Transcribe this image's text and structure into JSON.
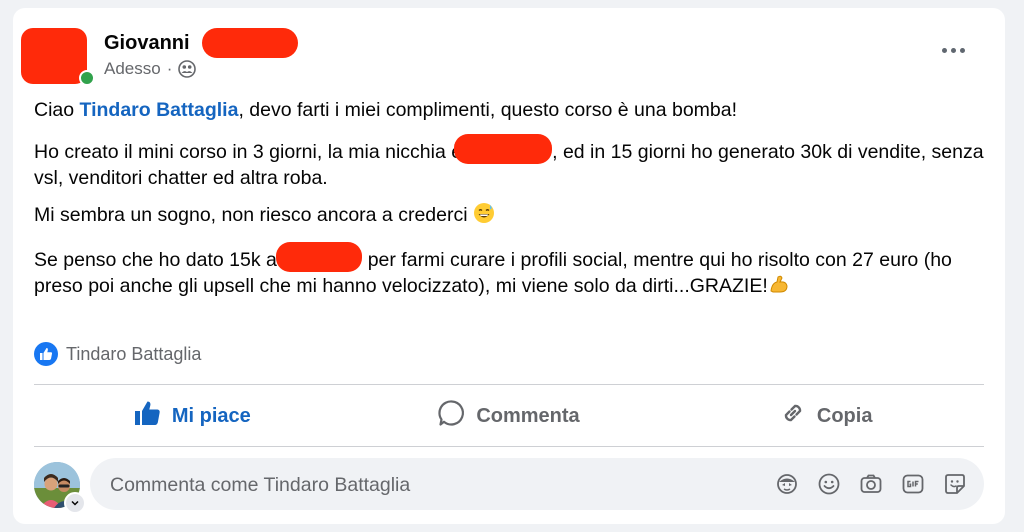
{
  "post": {
    "author_first_name": "Giovanni",
    "time": "Adesso",
    "separator": "·",
    "privacy_icon": "friends-icon",
    "text": {
      "p1_prefix": "Ciao ",
      "p1_mention": "Tindaro Battaglia",
      "p1_suffix": ", devo farti i miei complimenti, questo corso è una bomba!",
      "p2_a": "Ho creato il mini corso in 3 giorni, la mia nicchia è",
      "p2_b": ", ed in 15 giorni ho generato 30k di vendite, senza vsl, venditori chatter ed altra roba.",
      "p3": "Mi sembra un sogno, non riesco ancora a crederci ",
      "p4_a": "Se penso che ho dato 15k a ",
      "p4_b": " per farmi curare i profili social, mentre qui ho risolto con 27 euro (ho preso poi anche gli upsell che mi hanno velocizzato), mi viene solo da dirti...GRAZIE!"
    },
    "reactions": {
      "icon": "like-icon",
      "names": "Tindaro Battaglia"
    }
  },
  "actions": {
    "like_label": "Mi piace",
    "comment_label": "Commenta",
    "copy_label": "Copia"
  },
  "comment": {
    "placeholder": "Commenta come Tindaro Battaglia",
    "tools": [
      "avatar-sticker-icon",
      "emoji-icon",
      "camera-icon",
      "gif-icon",
      "sticker-icon"
    ]
  },
  "colors": {
    "accent": "#1565c0",
    "redaction": "#ff2a0a",
    "secondary_text": "#65676b"
  }
}
